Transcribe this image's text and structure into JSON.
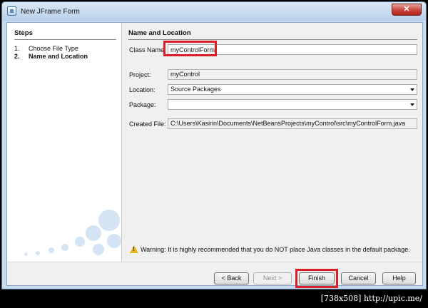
{
  "window": {
    "title": "New JFrame Form",
    "close_label": "✕"
  },
  "steps": {
    "title": "Steps",
    "items": [
      {
        "num": "1.",
        "label": "Choose File Type"
      },
      {
        "num": "2.",
        "label": "Name and Location"
      }
    ]
  },
  "form": {
    "section_title": "Name and Location",
    "class_name": {
      "label": "Class Name:",
      "value": "myControlForm"
    },
    "project": {
      "label": "Project:",
      "value": "myControl"
    },
    "location": {
      "label": "Location:",
      "value": "Source Packages"
    },
    "package": {
      "label": "Package:",
      "value": ""
    },
    "created_file": {
      "label": "Created File:",
      "value": "C:\\Users\\Kasirin\\Documents\\NetBeansProjects\\myControl\\src\\myControlForm.java"
    }
  },
  "warning": {
    "text": "Warning: It is highly recommended that you do NOT place Java classes in the default package."
  },
  "buttons": {
    "back": "< Back",
    "next": "Next >",
    "finish": "Finish",
    "cancel": "Cancel",
    "help": "Help"
  },
  "footer": {
    "text": "[738x508] http://upic.me/"
  },
  "colors": {
    "highlight": "#d91e26",
    "titlebar": "#c9dbee",
    "close": "#c8423a"
  }
}
